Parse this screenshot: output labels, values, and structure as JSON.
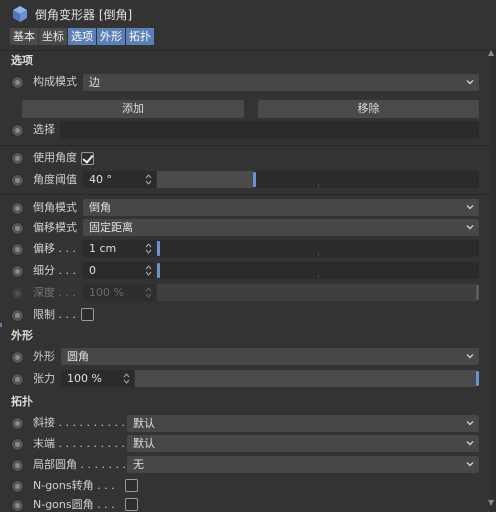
{
  "header": {
    "title": "倒角变形器 [倒角]",
    "tabs": [
      {
        "label": "基本",
        "active": false
      },
      {
        "label": "坐标",
        "active": false
      },
      {
        "label": "选项",
        "active": true
      },
      {
        "label": "外形",
        "active": true
      },
      {
        "label": "拓扑",
        "active": true
      }
    ]
  },
  "options": {
    "section_title": "选项",
    "mode_label": "构成模式",
    "mode_value": "边",
    "add_label": "添加",
    "remove_label": "移除",
    "selection_label": "选择",
    "selection_value": "",
    "use_angle_label": "使用角度",
    "use_angle_checked": true,
    "angle_label": "角度阈值",
    "angle_value": "40 °",
    "angle_fraction": 0.3,
    "bevel_mode_label": "倒角模式",
    "bevel_mode_value": "倒角",
    "offset_mode_label": "偏移模式",
    "offset_mode_value": "固定距离",
    "offset_label": "偏移 . . .",
    "offset_value": "1 cm",
    "offset_fraction": 0.0,
    "subdiv_label": "细分 . . .",
    "subdiv_value": "0",
    "subdiv_fraction": 0.0,
    "depth_label": "深度 . . .",
    "depth_value": "100 %",
    "depth_fraction": 1.0,
    "limit_label": "限制 . . .",
    "limit_checked": false
  },
  "shape": {
    "section_title": "外形",
    "shape_label": "外形",
    "shape_value": "圆角",
    "tension_label": "张力",
    "tension_value": "100 %",
    "tension_fraction": 1.0
  },
  "topology": {
    "section_title": "拓扑",
    "miter_label": "斜接 . . . . . . . . . .",
    "miter_value": "默认",
    "end_label": "末端 . . . . . . . . . .",
    "end_value": "默认",
    "partial_label": "局部圆角 . . . . . . .",
    "partial_value": "无",
    "ngon_corner_label": "N-gons转角 . . .",
    "ngon_corner_checked": false,
    "ngon_round_label": "N-gons圆角 . . .",
    "ngon_round_checked": false
  },
  "icons": {
    "object": "cube-icon",
    "radio": "animation-radio-icon",
    "chevron": "chevron-down-icon",
    "spinner": "spinner-arrows-icon",
    "check": "checkmark-icon"
  },
  "colors": {
    "background": "#333333",
    "accent": "#5b80b8",
    "knob": "#6c93d1",
    "field": "#2b2b2b",
    "dropdown": "#474747"
  }
}
